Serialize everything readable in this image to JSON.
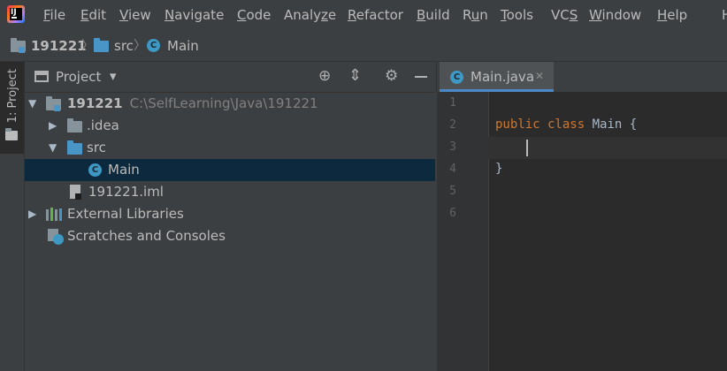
{
  "menu": {
    "items": [
      {
        "pre": "",
        "u": "F",
        "post": "ile"
      },
      {
        "pre": "",
        "u": "E",
        "post": "dit"
      },
      {
        "pre": "",
        "u": "V",
        "post": "iew"
      },
      {
        "pre": "",
        "u": "N",
        "post": "avigate"
      },
      {
        "pre": "",
        "u": "C",
        "post": "ode"
      },
      {
        "pre": "Analy",
        "u": "z",
        "post": "e"
      },
      {
        "pre": "",
        "u": "R",
        "post": "efactor"
      },
      {
        "pre": "",
        "u": "B",
        "post": "uild"
      },
      {
        "pre": "R",
        "u": "u",
        "post": "n"
      },
      {
        "pre": "",
        "u": "T",
        "post": "ools"
      },
      {
        "pre": "VC",
        "u": "S",
        "post": ""
      },
      {
        "pre": "",
        "u": "W",
        "post": "indow"
      },
      {
        "pre": "",
        "u": "H",
        "post": "elp"
      },
      {
        "pre": "H",
        "u": "",
        "post": ""
      }
    ]
  },
  "breadcrumb": {
    "project": "191221",
    "folder": "src",
    "file": "Main"
  },
  "strip": {
    "tab_label": "1: Project"
  },
  "panel": {
    "title": "Project",
    "dropdown": "▾"
  },
  "tree": {
    "root_name": "191221",
    "root_path": "C:\\SelfLearning\\Java\\191221",
    "idea": ".idea",
    "src": "src",
    "main": "Main",
    "iml": "191221.iml",
    "ext_libs": "External Libraries",
    "scratches": "Scratches and Consoles"
  },
  "editor": {
    "tab_label": "Main.java",
    "close": "✕",
    "line_numbers": [
      "1",
      "2",
      "3",
      "4",
      "5",
      "6"
    ],
    "line2_kw": "public class",
    "line2_rest": " Main {",
    "line4": "}"
  },
  "icons": {
    "class_letter": "C"
  },
  "colors": {
    "accent": "#4a88c7",
    "keyword": "#cc7832",
    "selection": "#0d293e"
  }
}
